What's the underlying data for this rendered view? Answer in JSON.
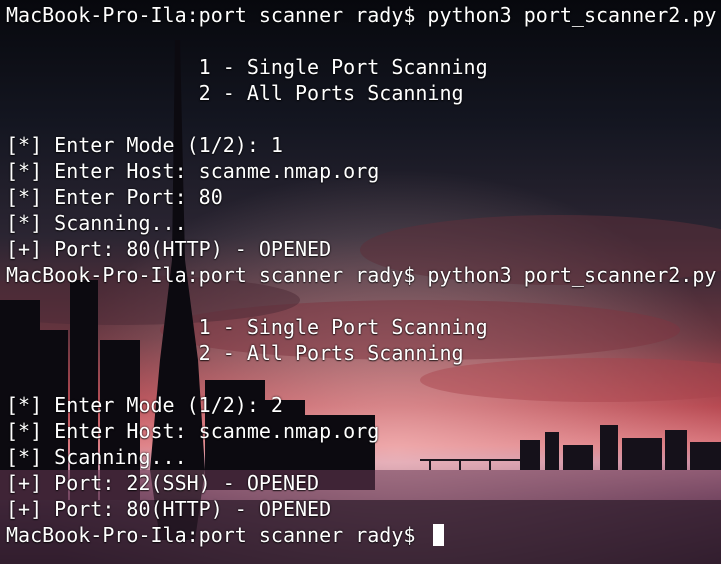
{
  "terminal": {
    "lines": [
      "MacBook-Pro-Ila:port scanner rady$ python3 port_scanner2.py",
      "",
      "                1 - Single Port Scanning",
      "                2 - All Ports Scanning",
      "",
      "[*] Enter Mode (1/2): 1",
      "[*] Enter Host: scanme.nmap.org",
      "[*] Enter Port: 80",
      "[*] Scanning...",
      "[+] Port: 80(HTTP) - OPENED",
      "MacBook-Pro-Ila:port scanner rady$ python3 port_scanner2.py",
      "",
      "                1 - Single Port Scanning",
      "                2 - All Ports Scanning",
      "",
      "[*] Enter Mode (1/2): 2",
      "[*] Enter Host: scanme.nmap.org",
      "[*] Scanning...",
      "[+] Port: 22(SSH) - OPENED",
      "[+] Port: 80(HTTP) - OPENED",
      "MacBook-Pro-Ila:port scanner rady$ "
    ]
  },
  "colors": {
    "text": "#ffffff",
    "cursor": "#ffffff",
    "sky_top": "#0b0d14",
    "sky_horizon": "#b8444f",
    "water": "#6a3b55"
  }
}
